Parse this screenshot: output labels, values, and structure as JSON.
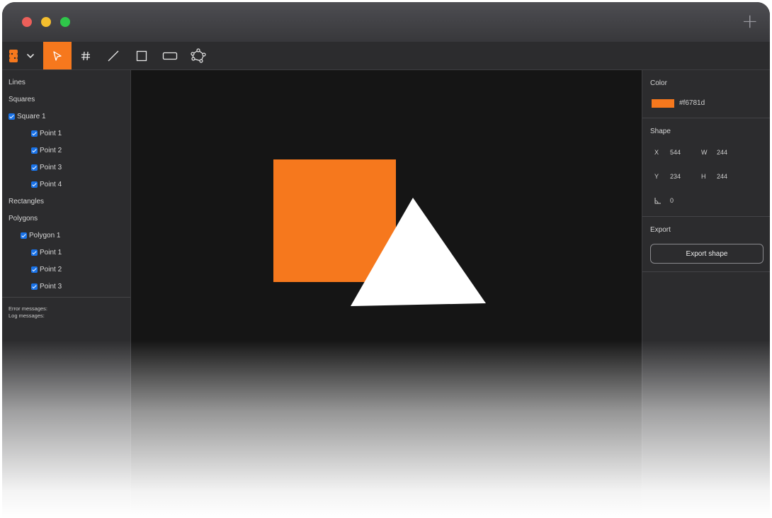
{
  "window": {
    "traffic_lights": [
      "#ec5f5a",
      "#f4be2e",
      "#2fc74a"
    ],
    "new_tab_label": "+"
  },
  "toolbar": {
    "accent": "#f6781d",
    "tools": [
      {
        "name": "logo-menu",
        "icon": "logo-icon"
      },
      {
        "name": "select",
        "icon": "pointer-icon",
        "active": true
      },
      {
        "name": "grid",
        "icon": "hash-icon"
      },
      {
        "name": "line",
        "icon": "line-icon"
      },
      {
        "name": "square",
        "icon": "square-icon"
      },
      {
        "name": "rectangle",
        "icon": "rectangle-icon"
      },
      {
        "name": "polygon",
        "icon": "polygon-icon"
      }
    ]
  },
  "tree": {
    "lines": "Lines",
    "squares": "Squares",
    "square1": "Square 1",
    "square_points": [
      "Point 1",
      "Point 2",
      "Point 3",
      "Point 4"
    ],
    "rectangles": "Rectangles",
    "polygons": "Polygons",
    "polygon1": "Polygon 1",
    "polygon_points": [
      "Point 1",
      "Point 2",
      "Point 3"
    ]
  },
  "messages": {
    "error": "Error messages:",
    "log": "Log messages:"
  },
  "properties": {
    "color_section": "Color",
    "color_value": "#f6781d",
    "shape_section": "Shape",
    "x_label": "X",
    "x_value": "544",
    "w_label": "W",
    "w_value": "244",
    "y_label": "Y",
    "y_value": "234",
    "h_label": "H",
    "h_value": "244",
    "angle_value": "0",
    "export_section": "Export",
    "export_button": "Export shape"
  },
  "canvas": {
    "square_color": "#f6781d",
    "triangle_color": "#ffffff"
  }
}
